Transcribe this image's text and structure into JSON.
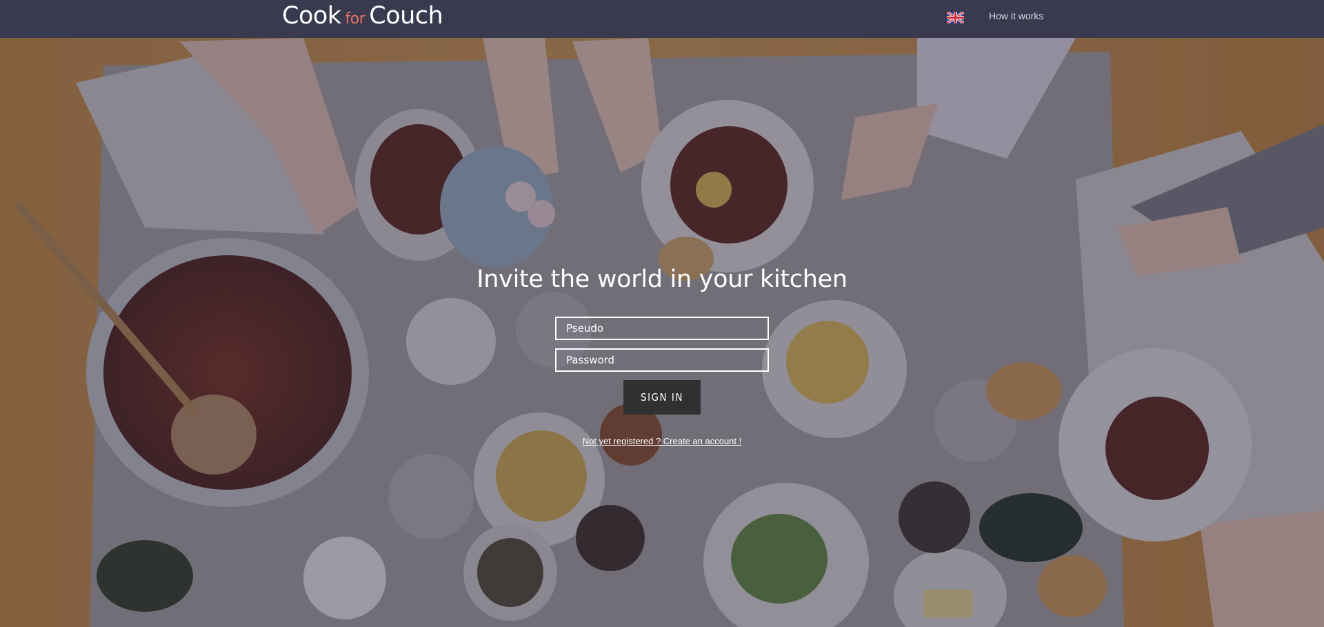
{
  "header": {
    "logo_left": "Cook",
    "logo_mid": "for",
    "logo_right": "Couch",
    "how_it_works": "How it works"
  },
  "icons": {
    "language": "uk-flag-icon"
  },
  "colors": {
    "header_bg": "#393a4e",
    "logo_accent": "#e8736a",
    "button_bg": "#303030"
  },
  "login": {
    "title": "Invite the world in your kitchen",
    "pseudo_placeholder": "Pseudo",
    "password_placeholder": "Password",
    "signin_label": "SIGN IN",
    "register_link": "Not yet registered ? Create an account !"
  }
}
